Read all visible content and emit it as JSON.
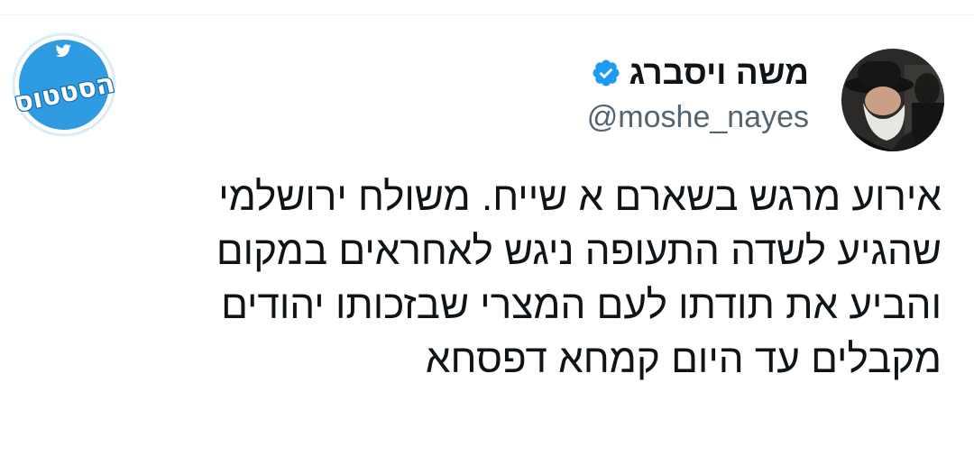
{
  "tweet": {
    "author": {
      "display_name": "משה ויסברג",
      "handle": "@moshe_nayes",
      "verified": true,
      "verified_color": "#1d9bf0",
      "avatar_icon": "profile-photo"
    },
    "text_lines": [
      "אירוע מרגש בשארם א שייח. משולח ירושלמי",
      "שהגיע לשדה התעופה ניגש לאחראים במקום",
      "והביע את תודתו לעם המצרי שבזכותו יהודים",
      "מקבלים עד היום קמחא דפסחא"
    ]
  },
  "watermark": {
    "text": "הסטטוס",
    "color": "#2f9be0",
    "icon": "twitter-bird-icon"
  },
  "colors": {
    "text_primary": "#0f1419",
    "text_secondary": "#536471",
    "divider": "#eff3f4"
  }
}
